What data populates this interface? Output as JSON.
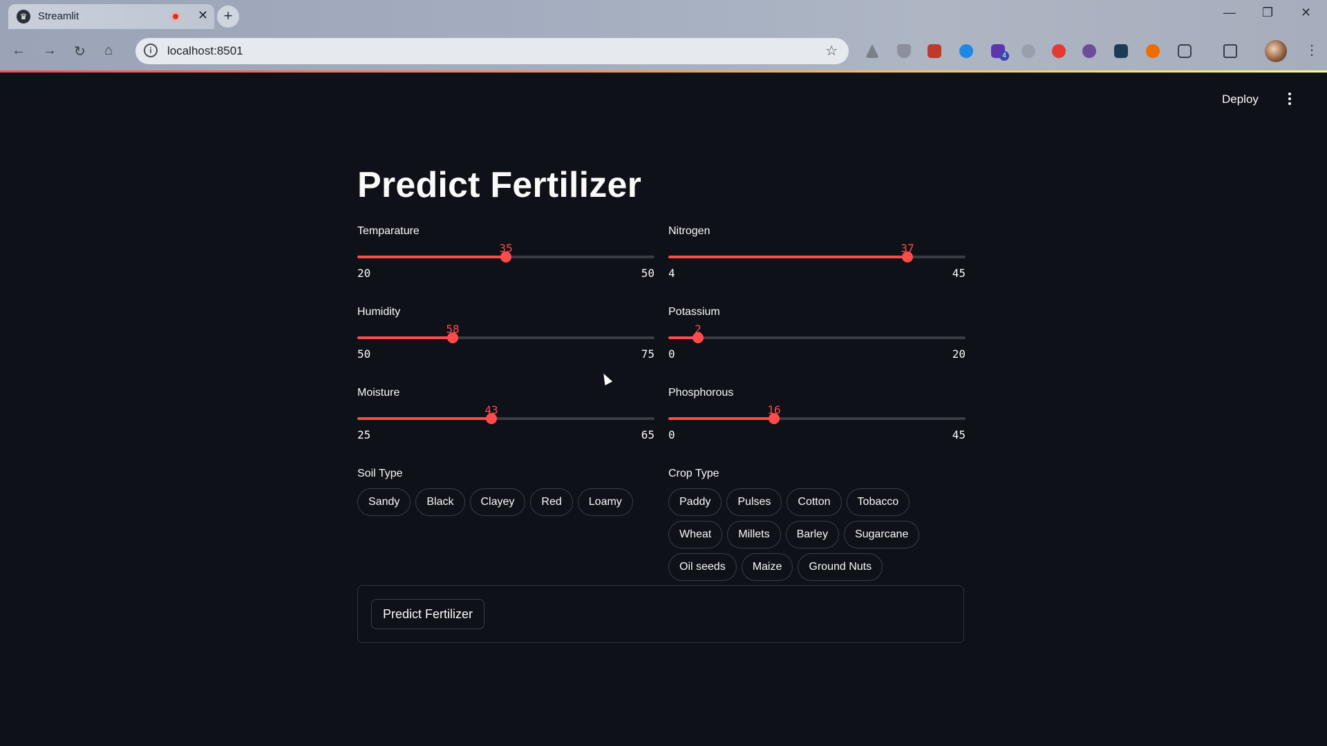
{
  "browser": {
    "tab_title": "Streamlit",
    "url": "localhost:8501",
    "new_tab": "+",
    "close_tab": "✕",
    "extension_badge": "4"
  },
  "header": {
    "deploy_label": "Deploy"
  },
  "page": {
    "title": "Predict Fertilizer"
  },
  "sliders": [
    {
      "label": "Temparature",
      "value": 35,
      "min": 20,
      "max": 50
    },
    {
      "label": "Humidity",
      "value": 58,
      "min": 50,
      "max": 75
    },
    {
      "label": "Moisture",
      "value": 43,
      "min": 25,
      "max": 65
    },
    {
      "label": "Nitrogen",
      "value": 37,
      "min": 4,
      "max": 45
    },
    {
      "label": "Potassium",
      "value": 2,
      "min": 0,
      "max": 20
    },
    {
      "label": "Phosphorous",
      "value": 16,
      "min": 0,
      "max": 45
    }
  ],
  "soil": {
    "label": "Soil Type",
    "options": [
      "Sandy",
      "Black",
      "Clayey",
      "Red",
      "Loamy"
    ]
  },
  "crop": {
    "label": "Crop Type",
    "options": [
      "Paddy",
      "Pulses",
      "Cotton",
      "Tobacco",
      "Wheat",
      "Millets",
      "Barley",
      "Sugarcane",
      "Oil seeds",
      "Maize",
      "Ground Nuts"
    ]
  },
  "form": {
    "submit_label": "Predict Fertilizer"
  },
  "colors": {
    "accent": "#ff4b4b",
    "background": "#0e1117",
    "track": "#3a3c45"
  }
}
